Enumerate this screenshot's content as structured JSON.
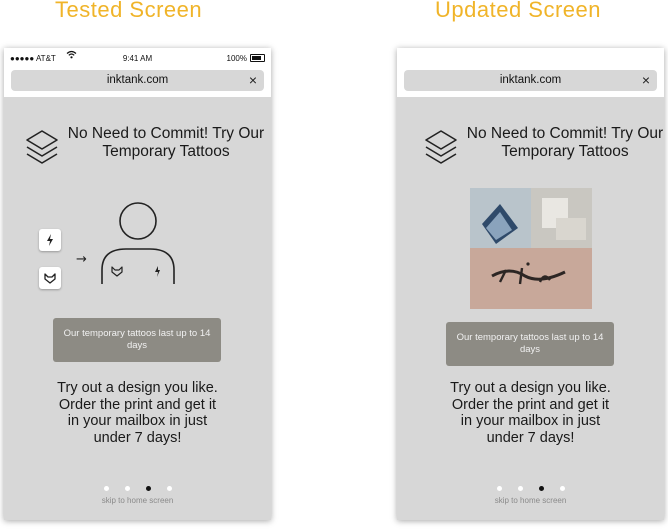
{
  "headings": {
    "tested": "Tested Screen",
    "updated": "Updated Screen"
  },
  "status_bar": {
    "carrier": "●●●●● AT&T",
    "time": "9:41 AM",
    "battery": "100%"
  },
  "browser": {
    "url": "inktank.com",
    "close_glyph": "×"
  },
  "screen": {
    "title": "No Need to Commit! Try Our Temporary Tattoos",
    "info_button": "Our temporary tattoos last up to 14 days",
    "body": "Try out a design you like. Order the print and get it in your mailbox in just under 7 days!",
    "skip": "skip to home screen"
  },
  "diagram": {
    "arrow": "→"
  },
  "pager": {
    "count": 4,
    "active_index": 2
  },
  "colors": {
    "heading": "#f0b429",
    "screen_bg": "#d7d7d7",
    "button_bg": "#8d8b84"
  }
}
